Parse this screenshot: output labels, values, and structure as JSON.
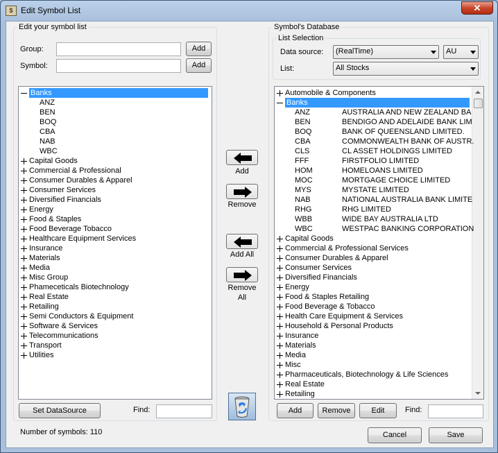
{
  "window": {
    "title": "Edit Symbol List",
    "close_label": "✕"
  },
  "left": {
    "group_title": "Edit your symbol list",
    "group_label": "Group:",
    "symbol_label": "Symbol:",
    "group_value": "",
    "symbol_value": "",
    "add_group_label": "Add",
    "add_symbol_label": "Add",
    "tree": {
      "expanded": {
        "label": "Banks",
        "children": [
          "ANZ",
          "BEN",
          "BOQ",
          "CBA",
          "NAB",
          "WBC"
        ]
      },
      "collapsed": [
        "Capital Goods",
        "Commercial & Professional",
        "Consumer Durables & Apparel",
        "Consumer Services",
        "Diversified Financials",
        "Energy",
        "Food & Staples",
        "Food Beverage Tobacco",
        "Healthcare Equipment Services",
        "Insurance",
        "Materials",
        "Media",
        "Misc Group",
        "Phameceticals Biotechnology",
        "Real Estate",
        "Retailing",
        "Semi Conductors & Equipment",
        "Software & Services",
        "Telecommunications",
        "Transport",
        "Utilities"
      ]
    },
    "set_datasource_label": "Set DataSource",
    "find_label": "Find:",
    "find_value": ""
  },
  "middle": {
    "add_label": "Add",
    "remove_label": "Remove",
    "add_all_label": "Add All",
    "remove_all_line1": "Remove",
    "remove_all_line2": "All"
  },
  "right": {
    "group_title": "Symbol's Database",
    "list_selection_title": "List Selection",
    "data_source_label": "Data source:",
    "data_source_value": "(RealTime)",
    "region_value": "AU",
    "list_label": "List:",
    "list_value": "All Stocks",
    "tree": {
      "before": [
        "Automobile & Components"
      ],
      "expanded": {
        "label": "Banks",
        "children": [
          {
            "code": "ANZ",
            "name": "AUSTRALIA AND NEW ZEALAND BA"
          },
          {
            "code": "BEN",
            "name": "BENDIGO AND ADELAIDE BANK LIM"
          },
          {
            "code": "BOQ",
            "name": "BANK OF QUEENSLAND LIMITED."
          },
          {
            "code": "CBA",
            "name": "COMMONWEALTH BANK OF AUSTR."
          },
          {
            "code": "CLS",
            "name": "CL ASSET HOLDINGS LIMITED"
          },
          {
            "code": "FFF",
            "name": "FIRSTFOLIO LIMITED"
          },
          {
            "code": "HOM",
            "name": "HOMELOANS LIMITED"
          },
          {
            "code": "MOC",
            "name": "MORTGAGE CHOICE LIMITED"
          },
          {
            "code": "MYS",
            "name": "MYSTATE LIMITED"
          },
          {
            "code": "NAB",
            "name": "NATIONAL AUSTRALIA BANK LIMITE"
          },
          {
            "code": "RHG",
            "name": "RHG LIMITED"
          },
          {
            "code": "WBB",
            "name": "WIDE BAY AUSTRALIA LTD"
          },
          {
            "code": "WBC",
            "name": "WESTPAC BANKING CORPORATION"
          }
        ]
      },
      "after": [
        "Capital Goods",
        "Commercial & Professional Services",
        "Consumer Durables & Apparel",
        "Consumer Services",
        "Diversified Financials",
        "Energy",
        "Food & Staples Retailing",
        "Food Beverage & Tobacco",
        "Health Care Equipment & Services",
        "Household & Personal Products",
        "Insurance",
        "Materials",
        "Media",
        "Misc",
        "Pharmaceuticals, Biotechnology & Life Sciences",
        "Real Estate",
        "Retailing"
      ]
    },
    "add_label": "Add",
    "remove_label": "Remove",
    "edit_label": "Edit",
    "find_label": "Find:",
    "find_value": ""
  },
  "footer": {
    "status": "Number of symbols: 110",
    "cancel_label": "Cancel",
    "save_label": "Save"
  },
  "colors": {
    "selection": "#3399ff",
    "title_gradient": "#a9c0dc",
    "close": "#c7462b"
  }
}
